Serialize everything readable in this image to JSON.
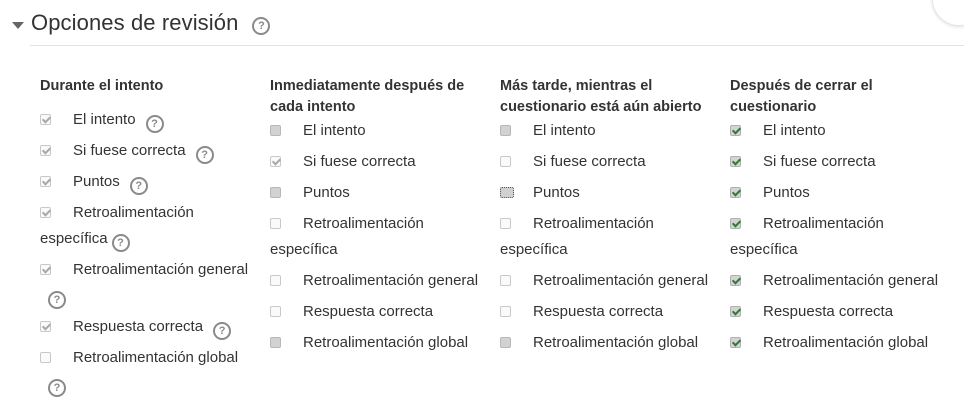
{
  "section": {
    "title": "Opciones de revisión",
    "help_icon": "question-circle-icon"
  },
  "columns": [
    {
      "heading": "Durante el intento",
      "options": [
        {
          "label": "El intento",
          "state": "checked-disabled",
          "help": true
        },
        {
          "label": "Si fuese correcta",
          "state": "checked-disabled",
          "help": true
        },
        {
          "label": "Puntos",
          "state": "checked-disabled",
          "help": true
        },
        {
          "label": "Retroalimentación específica",
          "state": "checked-disabled",
          "help": true
        },
        {
          "label": "Retroalimentación general",
          "state": "checked-disabled",
          "help": true
        },
        {
          "label": "Respuesta correcta",
          "state": "checked-disabled",
          "help": true
        },
        {
          "label": "Retroalimentación global",
          "state": "unchecked-disabled",
          "help": true
        }
      ]
    },
    {
      "heading": "Inmediatamente después de cada intento",
      "options": [
        {
          "label": "El intento",
          "state": "unchecked"
        },
        {
          "label": "Si fuese correcta",
          "state": "checked-disabled"
        },
        {
          "label": "Puntos",
          "state": "unchecked"
        },
        {
          "label": "Retroalimentación específica",
          "state": "unchecked-disabled"
        },
        {
          "label": "Retroalimentación general",
          "state": "unchecked-disabled"
        },
        {
          "label": "Respuesta correcta",
          "state": "unchecked-disabled"
        },
        {
          "label": "Retroalimentación global",
          "state": "unchecked"
        }
      ]
    },
    {
      "heading": "Más tarde, mientras el cuestionario está aún abierto",
      "options": [
        {
          "label": "El intento",
          "state": "unchecked"
        },
        {
          "label": "Si fuese correcta",
          "state": "unchecked-disabled"
        },
        {
          "label": "Puntos",
          "state": "unchecked-focused"
        },
        {
          "label": "Retroalimentación específica",
          "state": "unchecked-disabled"
        },
        {
          "label": "Retroalimentación general",
          "state": "unchecked-disabled"
        },
        {
          "label": "Respuesta correcta",
          "state": "unchecked-disabled"
        },
        {
          "label": "Retroalimentación global",
          "state": "unchecked"
        }
      ]
    },
    {
      "heading": "Después de cerrar el cuestionario",
      "options": [
        {
          "label": "El intento",
          "state": "checked"
        },
        {
          "label": "Si fuese correcta",
          "state": "checked"
        },
        {
          "label": "Puntos",
          "state": "checked"
        },
        {
          "label": "Retroalimentación específica",
          "state": "checked"
        },
        {
          "label": "Retroalimentación general",
          "state": "checked"
        },
        {
          "label": "Respuesta correcta",
          "state": "checked"
        },
        {
          "label": "Retroalimentación global",
          "state": "checked"
        }
      ]
    }
  ],
  "colors": {
    "text": "#333333",
    "checkmark_active": "#2e7d32",
    "checkmark_disabled": "#a8a8a8",
    "rule": "#e3e3e3"
  }
}
